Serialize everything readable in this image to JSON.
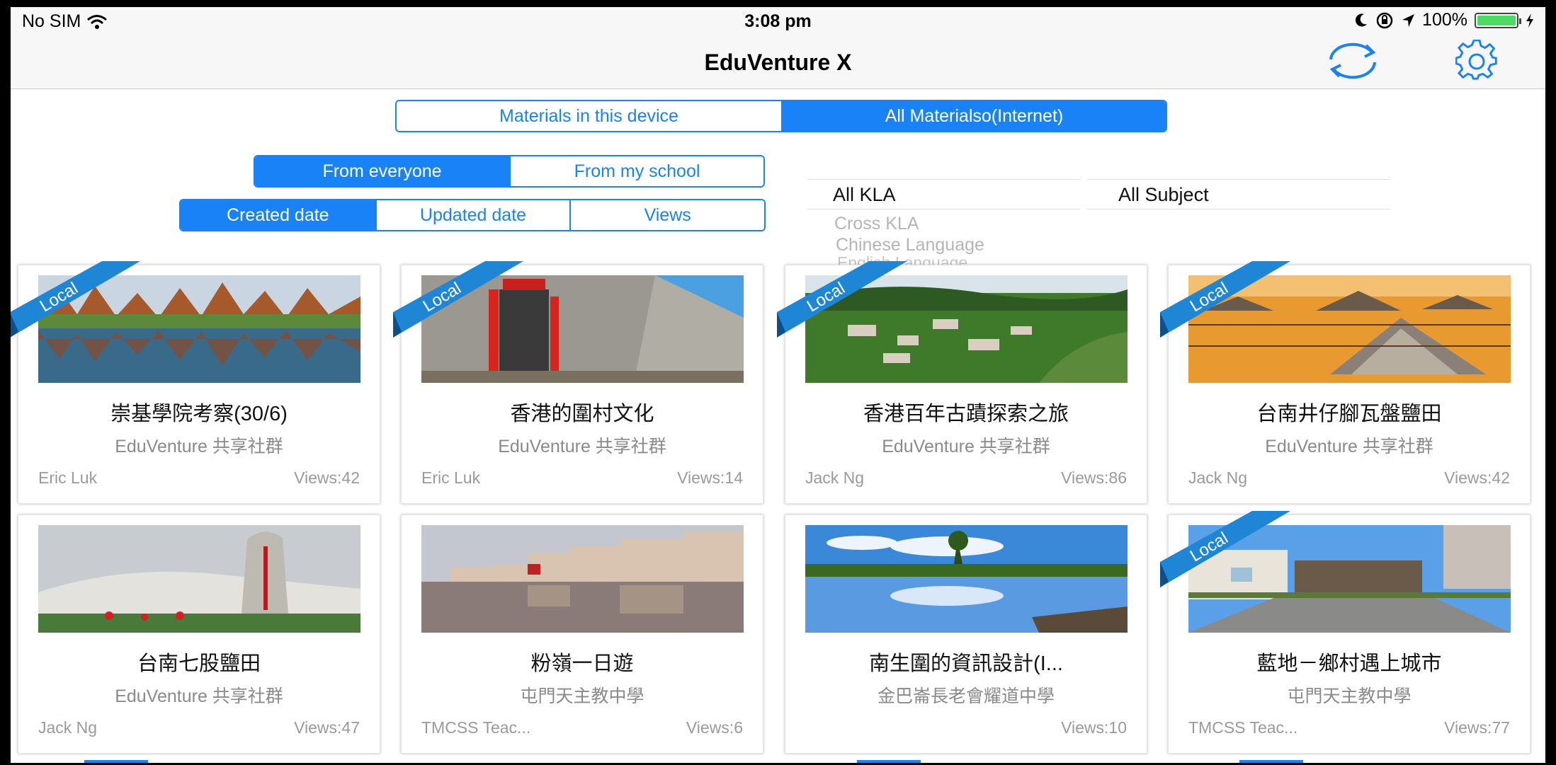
{
  "status": {
    "carrier": "No SIM",
    "time": "3:08 pm",
    "battery": "100%"
  },
  "nav": {
    "title": "EduVenture X"
  },
  "source_tabs": [
    "Materials in this device",
    "All Materialso(Internet)"
  ],
  "owner_tabs": [
    "From everyone",
    "From my school"
  ],
  "sort_tabs": [
    "Created date",
    "Updated date",
    "Views"
  ],
  "picker": {
    "kla_selected": "All KLA",
    "subject_selected": "All Subject",
    "kla_options": [
      "Cross KLA",
      "Chinese Language",
      "English Language"
    ]
  },
  "ribbon_label": "Local",
  "cards": [
    {
      "title": "崇基學院考察(30/6)",
      "community": "EduVenture 共享社群",
      "author": "Eric Luk",
      "views": "Views:42",
      "local": true,
      "thumb": "lake-trees"
    },
    {
      "title": "香港的圍村文化",
      "community": "EduVenture 共享社群",
      "author": "Eric Luk",
      "views": "Views:14",
      "local": true,
      "thumb": "walled-village"
    },
    {
      "title": "香港百年古蹟探索之旅",
      "community": "EduVenture 共享社群",
      "author": "Jack Ng",
      "views": "Views:86",
      "local": true,
      "thumb": "hill-village"
    },
    {
      "title": "台南井仔腳瓦盤鹽田",
      "community": "EduVenture 共享社群",
      "author": "Jack Ng",
      "views": "Views:42",
      "local": true,
      "thumb": "salt-field-sunset"
    },
    {
      "title": "台南七股鹽田",
      "community": "EduVenture 共享社群",
      "author": "Jack Ng",
      "views": "Views:47",
      "local": false,
      "thumb": "salt-mountain"
    },
    {
      "title": "粉嶺一日遊",
      "community": "屯門天主教中學",
      "author": "TMCSS Teac...",
      "views": "Views:6",
      "local": false,
      "thumb": "river-houses"
    },
    {
      "title": "南生圍的資訊設計(I...",
      "community": "金巴崙長老會耀道中學",
      "author": "",
      "views": "Views:10",
      "local": false,
      "thumb": "wetland"
    },
    {
      "title": "藍地－鄉村遇上城市",
      "community": "屯門天主教中學",
      "author": "TMCSS Teac...",
      "views": "Views:77",
      "local": true,
      "thumb": "village-road"
    }
  ],
  "colors": {
    "accent": "#1a82f7",
    "ribbon": "#1f86d6"
  }
}
